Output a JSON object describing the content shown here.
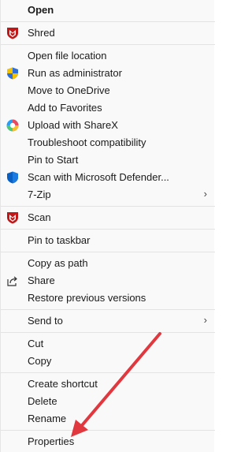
{
  "menu": {
    "items": [
      {
        "label": "Open",
        "icon": ""
      },
      {
        "label": "Shred",
        "icon": "mcafee-shield-icon"
      },
      {
        "label": "Open file location",
        "icon": ""
      },
      {
        "label": "Run as administrator",
        "icon": "uac-shield-icon"
      },
      {
        "label": "Move to OneDrive",
        "icon": ""
      },
      {
        "label": "Add to Favorites",
        "icon": ""
      },
      {
        "label": "Upload with ShareX",
        "icon": "sharex-icon"
      },
      {
        "label": "Troubleshoot compatibility",
        "icon": ""
      },
      {
        "label": "Pin to Start",
        "icon": ""
      },
      {
        "label": "Scan with Microsoft Defender...",
        "icon": "defender-shield-icon"
      },
      {
        "label": "7-Zip",
        "icon": "",
        "submenu": true
      },
      {
        "label": "Scan",
        "icon": "mcafee-shield-icon"
      },
      {
        "label": "Pin to taskbar",
        "icon": ""
      },
      {
        "label": "Copy as path",
        "icon": ""
      },
      {
        "label": "Share",
        "icon": "share-icon"
      },
      {
        "label": "Restore previous versions",
        "icon": ""
      },
      {
        "label": "Send to",
        "icon": "",
        "submenu": true
      },
      {
        "label": "Cut",
        "icon": ""
      },
      {
        "label": "Copy",
        "icon": ""
      },
      {
        "label": "Create shortcut",
        "icon": ""
      },
      {
        "label": "Delete",
        "icon": ""
      },
      {
        "label": "Rename",
        "icon": ""
      },
      {
        "label": "Properties",
        "icon": ""
      }
    ]
  },
  "colors": {
    "annotation_arrow": "#e0383e",
    "mcafee_red": "#c01818",
    "uac_blue": "#2f6fd6",
    "uac_yellow": "#f2c200",
    "defender_blue": "#0a5fc2"
  }
}
